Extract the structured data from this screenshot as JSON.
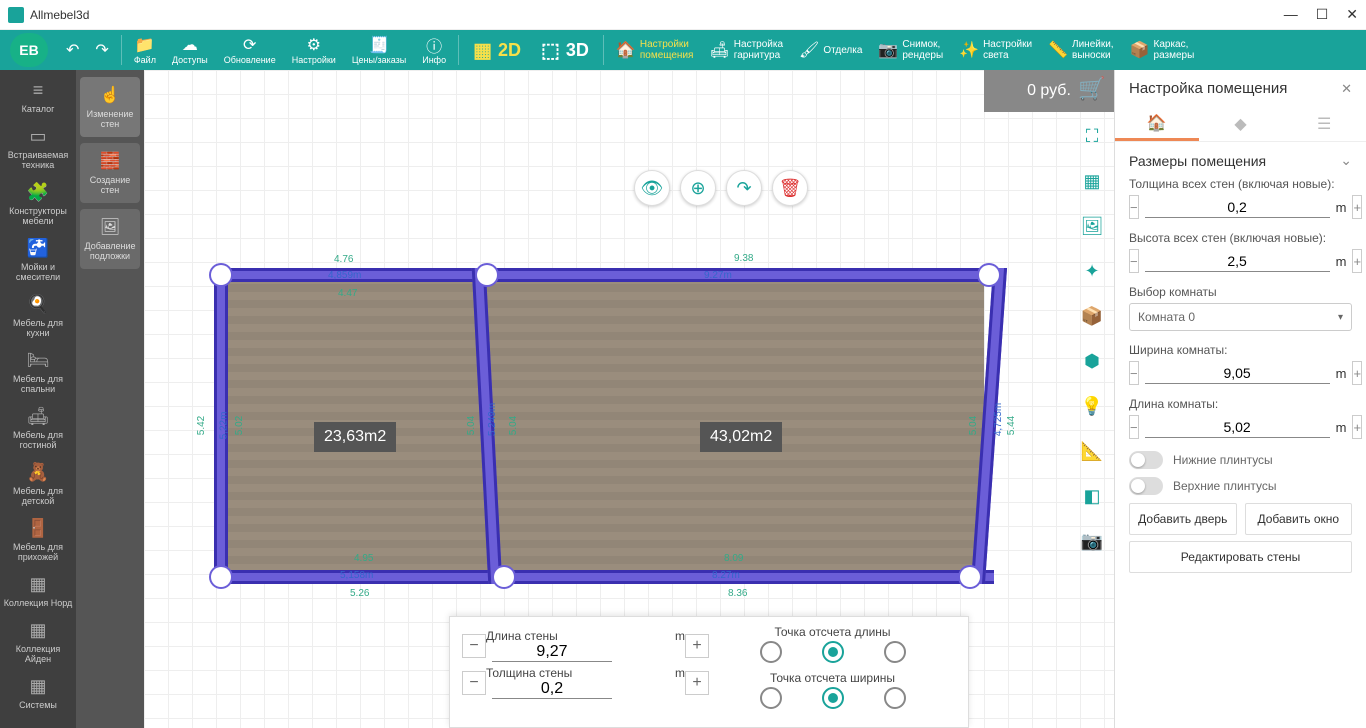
{
  "app_title": "Allmebel3d",
  "price": "0 руб.",
  "topbar": {
    "eb": "EB",
    "items": [
      {
        "icon": "📁",
        "label": "Файл"
      },
      {
        "icon": "☁",
        "label": "Доступы"
      },
      {
        "icon": "⟳",
        "label": "Обновление"
      },
      {
        "icon": "⚙",
        "label": "Настройки"
      },
      {
        "icon": "🧾",
        "label": "Цены/заказы"
      },
      {
        "icon": "ⓘ",
        "label": "Инфо"
      }
    ],
    "mode2d": "2D",
    "mode3d": "3D",
    "wide": [
      {
        "icon": "🏠",
        "l1": "Настройки",
        "l2": "помещения",
        "active": true
      },
      {
        "icon": "🛋",
        "l1": "Настройка",
        "l2": "гарнитура"
      },
      {
        "icon": "🖌",
        "l1": "Отделка",
        "l2": ""
      },
      {
        "icon": "📷",
        "l1": "Снимок,",
        "l2": "рендеры"
      },
      {
        "icon": "✨",
        "l1": "Настройки",
        "l2": "света"
      },
      {
        "icon": "📏",
        "l1": "Линейки,",
        "l2": "выноски"
      },
      {
        "icon": "📦",
        "l1": "Каркас,",
        "l2": "размеры"
      }
    ]
  },
  "sidebar": [
    {
      "icon": "≡",
      "label": "Каталог"
    },
    {
      "icon": "▭",
      "label": "Встраиваемая техника"
    },
    {
      "icon": "🧩",
      "label": "Конструкторы мебели"
    },
    {
      "icon": "🚰",
      "label": "Мойки и смесители"
    },
    {
      "icon": "🍳",
      "label": "Мебель для кухни"
    },
    {
      "icon": "🛏",
      "label": "Мебель для спальни"
    },
    {
      "icon": "🛋",
      "label": "Мебель для гостиной"
    },
    {
      "icon": "🧸",
      "label": "Мебель для детской"
    },
    {
      "icon": "🚪",
      "label": "Мебель для прихожей"
    },
    {
      "icon": "▦",
      "label": "Коллекция Норд"
    },
    {
      "icon": "▦",
      "label": "Коллекция Айден"
    },
    {
      "icon": "▦",
      "label": "Системы"
    }
  ],
  "sidebar2": [
    {
      "icon": "☝",
      "label": "Изменение стен",
      "on": true
    },
    {
      "icon": "🧱",
      "label": "Создание стен"
    },
    {
      "icon": "🖼",
      "label": "Добавление подложки"
    }
  ],
  "canvas": {
    "area1": "23,63m2",
    "area2": "43,02m2",
    "top_outer": "4.76",
    "top_w1": "4,859m",
    "top_seg": "4.47",
    "top_w2": "9.27m",
    "top_outer2": "9.38",
    "left_outer": "5.42",
    "left_w": "5,22m",
    "left_seg": "5.02",
    "mid_seg_l": "5.04",
    "mid_w": "5.249m",
    "mid_seg_r": "5.04",
    "right_seg": "5.04",
    "right_w": "4,725m",
    "right_outer": "5.44",
    "bot_seg1": "4.95",
    "bot_w1": "5,158m",
    "bot_outer1": "5.26",
    "bot_seg2": "8.09",
    "bot_w2": "8.27m",
    "bot_outer2": "8.36"
  },
  "bottom": {
    "len_label": "Длина стены",
    "len_val": "9,27",
    "len_unit": "m",
    "thk_label": "Толщина стены",
    "thk_val": "0,2",
    "thk_unit": "m",
    "origin_len": "Точка отсчета длины",
    "origin_wid": "Точка отсчета ширины"
  },
  "right": {
    "title": "Настройка помещения",
    "section": "Размеры помещения",
    "thk_all": "Толщина всех стен (включая новые):",
    "thk_all_val": "0,2",
    "h_all": "Высота всех стен (включая новые):",
    "h_all_val": "2,5",
    "room_sel_lbl": "Выбор комнаты",
    "room_sel": "Комната 0",
    "room_w_lbl": "Ширина комнаты:",
    "room_w": "9,05",
    "room_l_lbl": "Длина комнаты:",
    "room_l": "5,02",
    "unit": "m",
    "plinth_lo": "Нижние плинтусы",
    "plinth_hi": "Верхние плинтусы",
    "add_door": "Добавить дверь",
    "add_win": "Добавить окно",
    "edit_walls": "Редактировать стены"
  }
}
